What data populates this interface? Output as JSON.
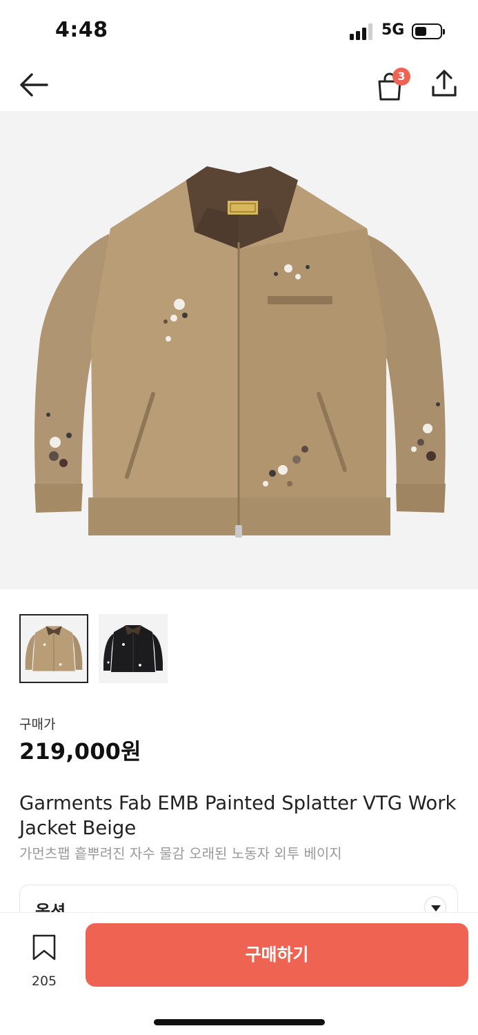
{
  "status_bar": {
    "time": "4:48",
    "network": "5G",
    "signal_bars_active": 3,
    "signal_bars_total": 4,
    "battery_level": 0.45
  },
  "nav": {
    "back_icon": "arrow-left-icon",
    "cart_icon": "shopping-bag-icon",
    "cart_badge": "3",
    "share_icon": "share-upload-icon"
  },
  "gallery": {
    "thumbnails": [
      {
        "color": "beige",
        "selected": true
      },
      {
        "color": "black",
        "selected": false
      }
    ]
  },
  "product": {
    "price_label": "구매가",
    "price": "219,000원",
    "title_en": "Garments Fab EMB Painted Splatter VTG Work Jacket Beige",
    "title_ko": "가먼츠팹 흩뿌려진 자수 물감 오래된 노동자 외투 베이지"
  },
  "options": {
    "label": "옵션"
  },
  "bottom_bar": {
    "bookmark_icon": "bookmark-icon",
    "bookmark_count": "205",
    "buy_label": "구매하기"
  },
  "colors": {
    "accent": "#ef6353",
    "jacket_beige": "#b59a72",
    "collar_brown": "#5a4535",
    "jacket_black": "#1c1c1e"
  }
}
